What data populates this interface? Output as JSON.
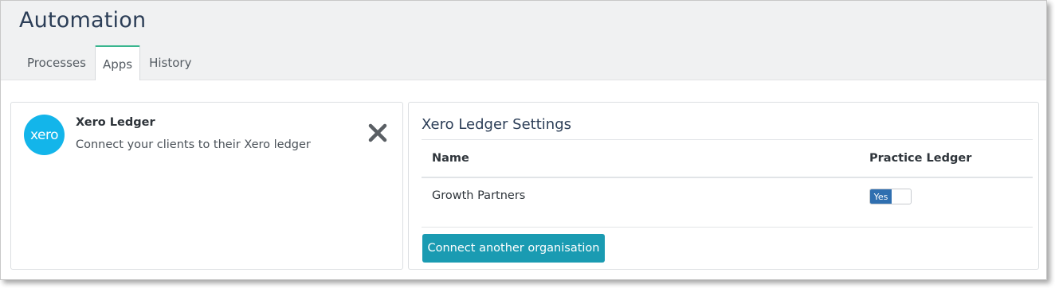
{
  "page": {
    "title": "Automation"
  },
  "tabs": [
    {
      "label": "Processes",
      "active": false
    },
    {
      "label": "Apps",
      "active": true
    },
    {
      "label": "History",
      "active": false
    }
  ],
  "app_card": {
    "logo_text": "xero",
    "logo_icon": "xero-logo-icon",
    "name": "Xero Ledger",
    "description": "Connect your clients to their Xero ledger",
    "close_icon": "close-icon"
  },
  "settings": {
    "title": "Xero Ledger Settings",
    "columns": [
      "Name",
      "Practice Ledger"
    ],
    "rows": [
      {
        "name": "Growth Partners",
        "practice_ledger": "Yes"
      }
    ],
    "connect_button_label": "Connect another organisation"
  },
  "colors": {
    "accent_tab": "#38b58e",
    "xero_blue": "#13b5ea",
    "toggle_on": "#2f6fb0",
    "button": "#1a9bb2",
    "title": "#2c3e57"
  }
}
